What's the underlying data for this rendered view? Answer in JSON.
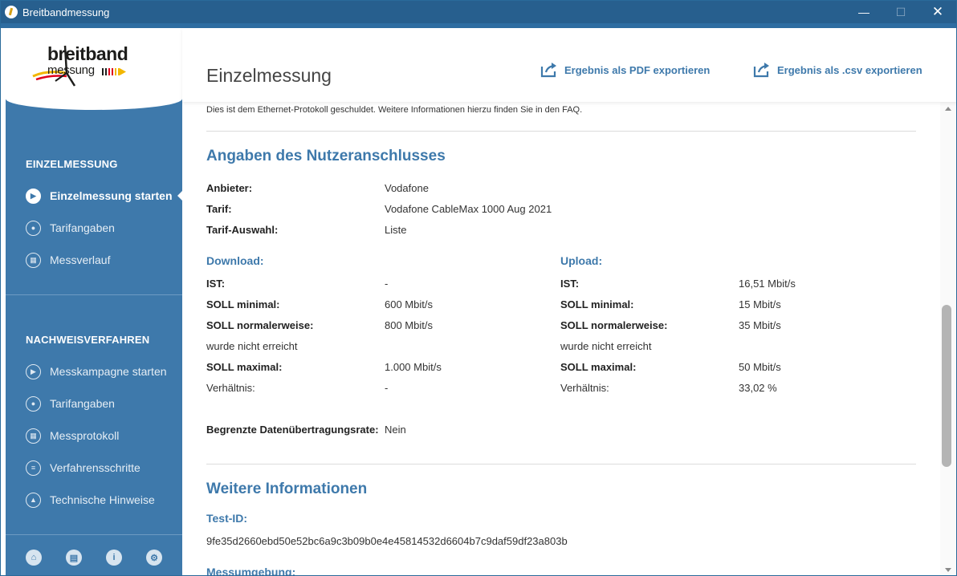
{
  "window": {
    "title": "Breitbandmessung"
  },
  "logo": {
    "line1": "breitband",
    "line2": "messung"
  },
  "sidebar": {
    "section1_heading": "EINZELMESSUNG",
    "section1_items": [
      {
        "label": "Einzelmessung starten",
        "icon": "play-circle-icon"
      },
      {
        "label": "Tarifangaben",
        "icon": "user-card-icon"
      },
      {
        "label": "Messverlauf",
        "icon": "calendar-icon"
      }
    ],
    "section2_heading": "NACHWEISVERFAHREN",
    "section2_items": [
      {
        "label": "Messkampagne starten",
        "icon": "play-circle-icon"
      },
      {
        "label": "Tarifangaben",
        "icon": "user-card-icon"
      },
      {
        "label": "Messprotokoll",
        "icon": "calendar-icon"
      },
      {
        "label": "Verfahrensschritte",
        "icon": "list-icon"
      },
      {
        "label": "Technische Hinweise",
        "icon": "warning-icon"
      }
    ],
    "footer_icons": [
      "home-icon",
      "chat-icon",
      "info-icon",
      "gear-icon"
    ]
  },
  "header": {
    "title": "Einzelmessung",
    "export_pdf": "Ergebnis als PDF exportieren",
    "export_csv": "Ergebnis als .csv exportieren"
  },
  "content": {
    "intro": "Dies ist dem Ethernet-Protokoll geschuldet. Weitere Informationen hierzu finden Sie in den FAQ.",
    "connection_title": "Angaben des Nutzeranschlusses",
    "provider_label": "Anbieter:",
    "provider_value": "Vodafone",
    "tariff_label": "Tarif:",
    "tariff_value": "Vodafone CableMax 1000 Aug 2021",
    "tariff_selection_label": "Tarif-Auswahl:",
    "tariff_selection_value": "Liste",
    "download": {
      "title": "Download:",
      "ist_label": "IST:",
      "ist_value": "-",
      "soll_min_label": "SOLL minimal:",
      "soll_min_value": "600 Mbit/s",
      "soll_norm_label": "SOLL normalerweise:",
      "soll_norm_value": "800 Mbit/s",
      "not_reached": "wurde nicht erreicht",
      "soll_max_label": "SOLL maximal:",
      "soll_max_value": "1.000 Mbit/s",
      "ratio_label": "Verhältnis:",
      "ratio_value": "-"
    },
    "upload": {
      "title": "Upload:",
      "ist_label": "IST:",
      "ist_value": "16,51 Mbit/s",
      "soll_min_label": "SOLL minimal:",
      "soll_min_value": "15 Mbit/s",
      "soll_norm_label": "SOLL normalerweise:",
      "soll_norm_value": "35 Mbit/s",
      "not_reached": "wurde nicht erreicht",
      "soll_max_label": "SOLL maximal:",
      "soll_max_value": "50 Mbit/s",
      "ratio_label": "Verhältnis:",
      "ratio_value": "33,02 %"
    },
    "limited_label": "Begrenzte Datenübertragungsrate:",
    "limited_value": "Nein",
    "more_info_title": "Weitere Informationen",
    "test_id_label": "Test-ID:",
    "test_id_value": "9fe35d2660ebd50e52bc6a9c3b09b0e4e45814532d6604b7c9daf59df23a803b",
    "environment_label": "Messumgebung:"
  },
  "colors": {
    "accent": "#3e79ab",
    "titlebar": "#275f8e",
    "sidebar": "#3e79ab"
  }
}
